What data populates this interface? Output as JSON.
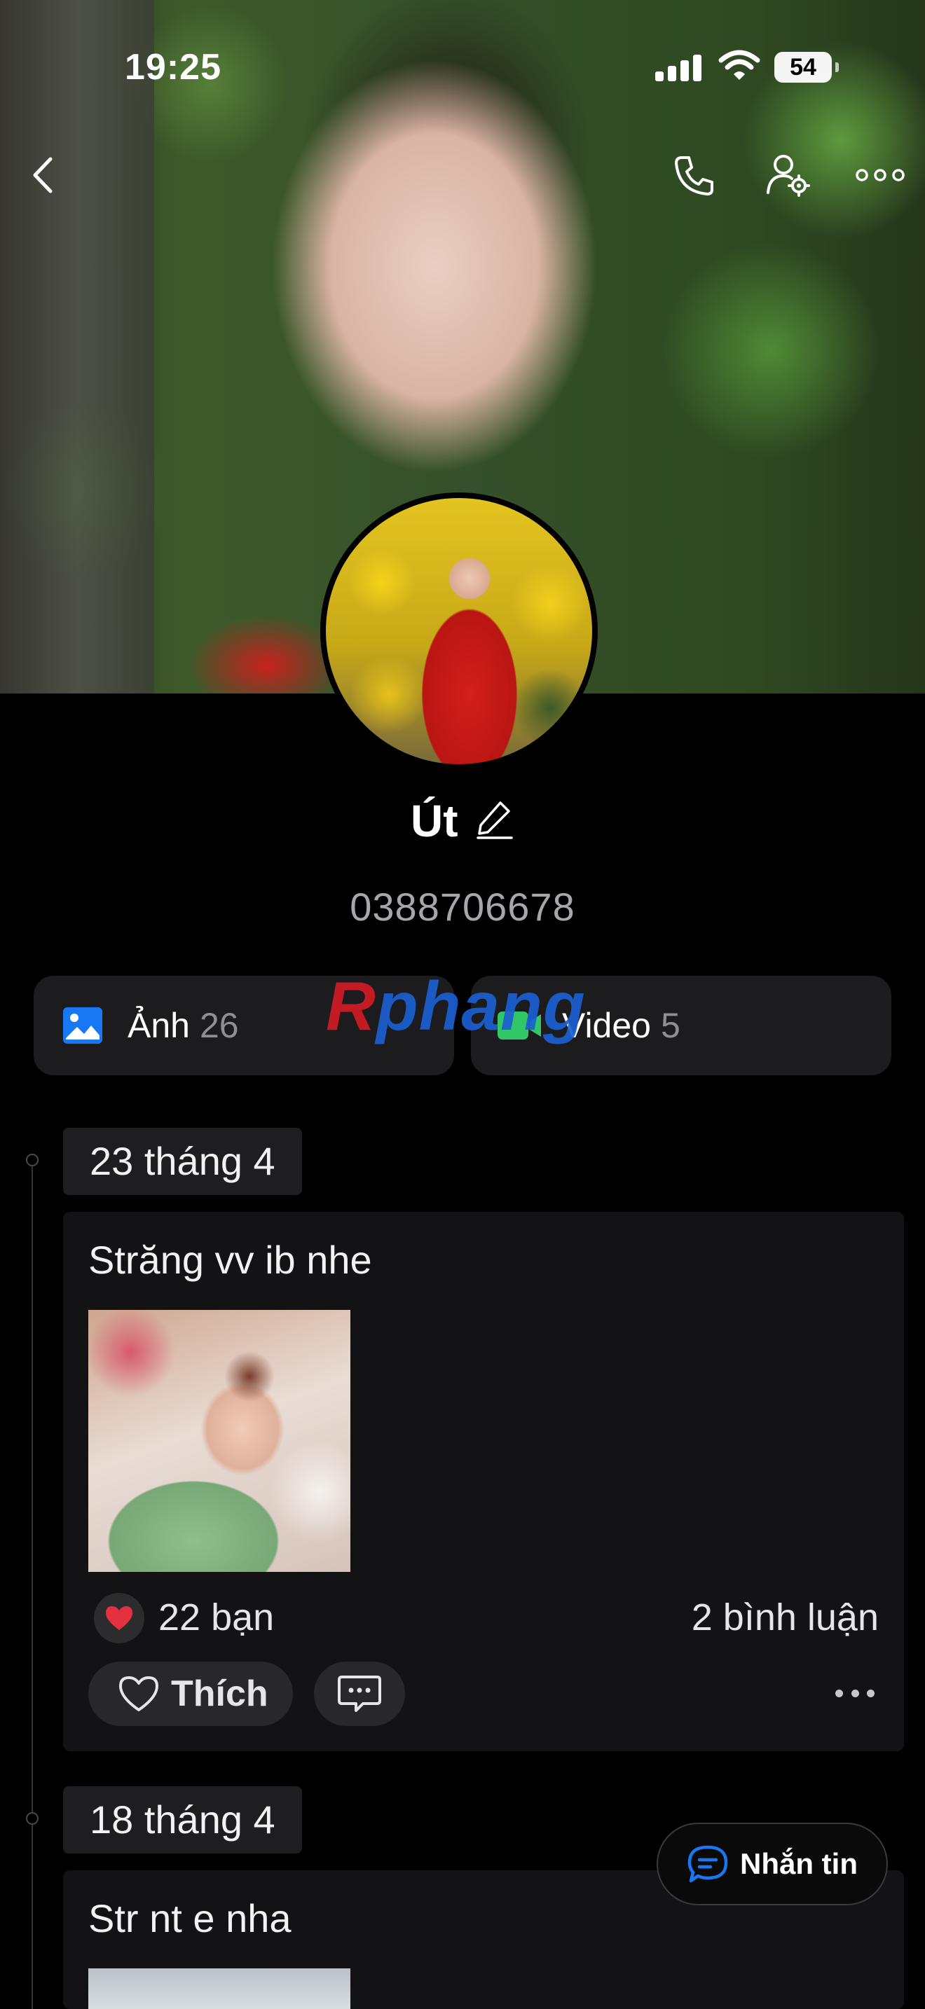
{
  "status_bar": {
    "time": "19:25",
    "battery": "54"
  },
  "nav": {
    "back_icon": "chevron-left-icon",
    "call_icon": "phone-icon",
    "profile_settings_icon": "user-settings-icon",
    "more_icon": "more-horizontal-icon"
  },
  "profile": {
    "name": "Út",
    "phone": "0388706678"
  },
  "media": {
    "photos": {
      "label": "Ảnh",
      "count": "26",
      "icon": "image-icon"
    },
    "videos": {
      "label": "Video",
      "count": "5",
      "icon": "video-icon"
    }
  },
  "watermark": {
    "part1": "R",
    "part2": "phang"
  },
  "timeline": [
    {
      "date": "23 tháng 4",
      "text": "Străng vv ib nhe",
      "reaction_count": "22 bạn",
      "comments": "2 bình luận",
      "like_label": "Thích"
    },
    {
      "date": "18 tháng 4",
      "text": "Str nt e nha"
    }
  ],
  "chat_button": {
    "label": "Nhắn tin"
  },
  "colors": {
    "background": "#000000",
    "card": "#131315",
    "accent_blue": "#1877f2",
    "video_green": "#32c766",
    "heart_red": "#e4303f"
  }
}
